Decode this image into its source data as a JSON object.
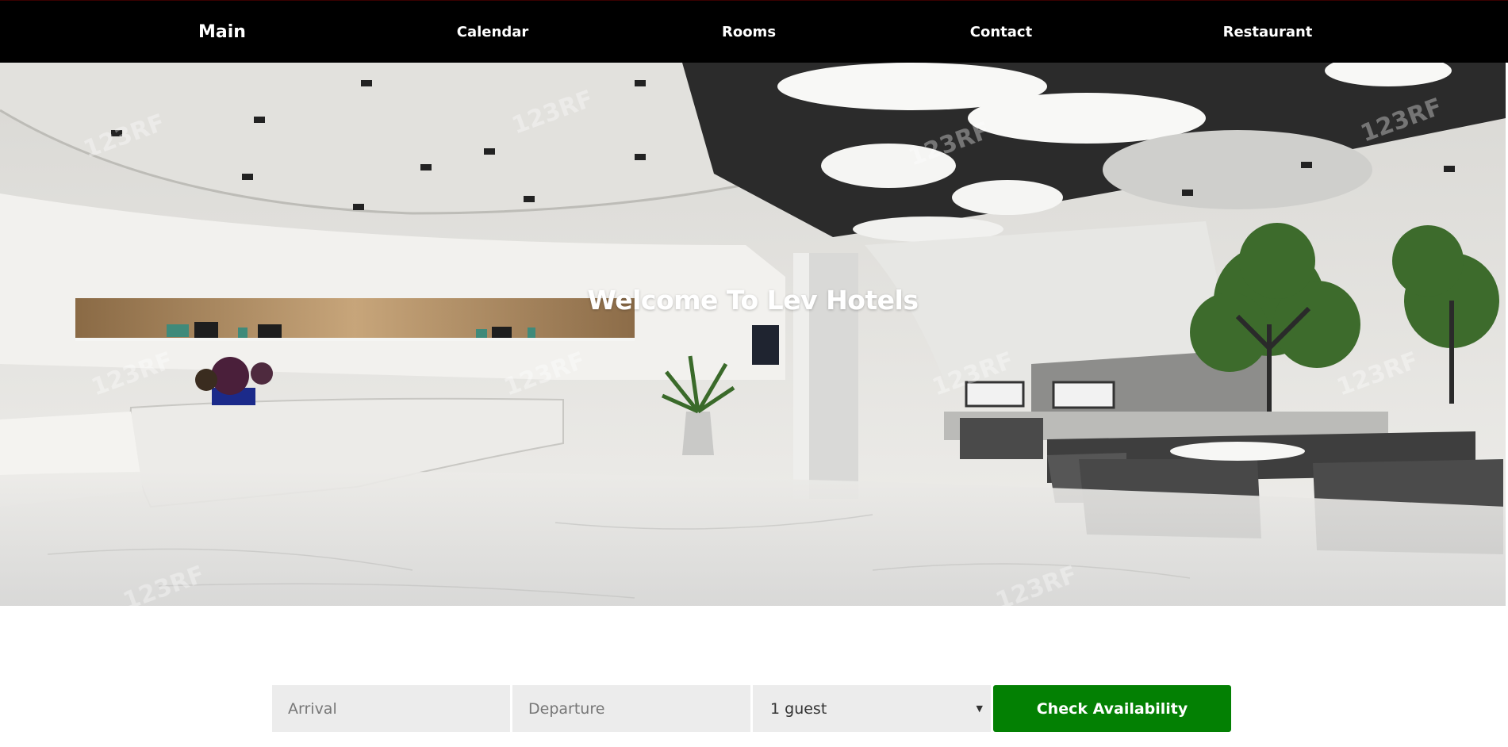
{
  "nav": {
    "items": [
      {
        "label": "Main"
      },
      {
        "label": "Calendar"
      },
      {
        "label": "Rooms"
      },
      {
        "label": "Contact"
      },
      {
        "label": "Restaurant"
      }
    ]
  },
  "hero": {
    "title": "Welcome To Lev Hotels",
    "watermark": "123RF"
  },
  "booking": {
    "arrival_placeholder": "Arrival",
    "departure_placeholder": "Departure",
    "guests_value": "1 guest",
    "check_label": "Check Availability"
  },
  "colors": {
    "nav_bg": "#000000",
    "accent": "#038003",
    "field_bg": "#ececec"
  }
}
